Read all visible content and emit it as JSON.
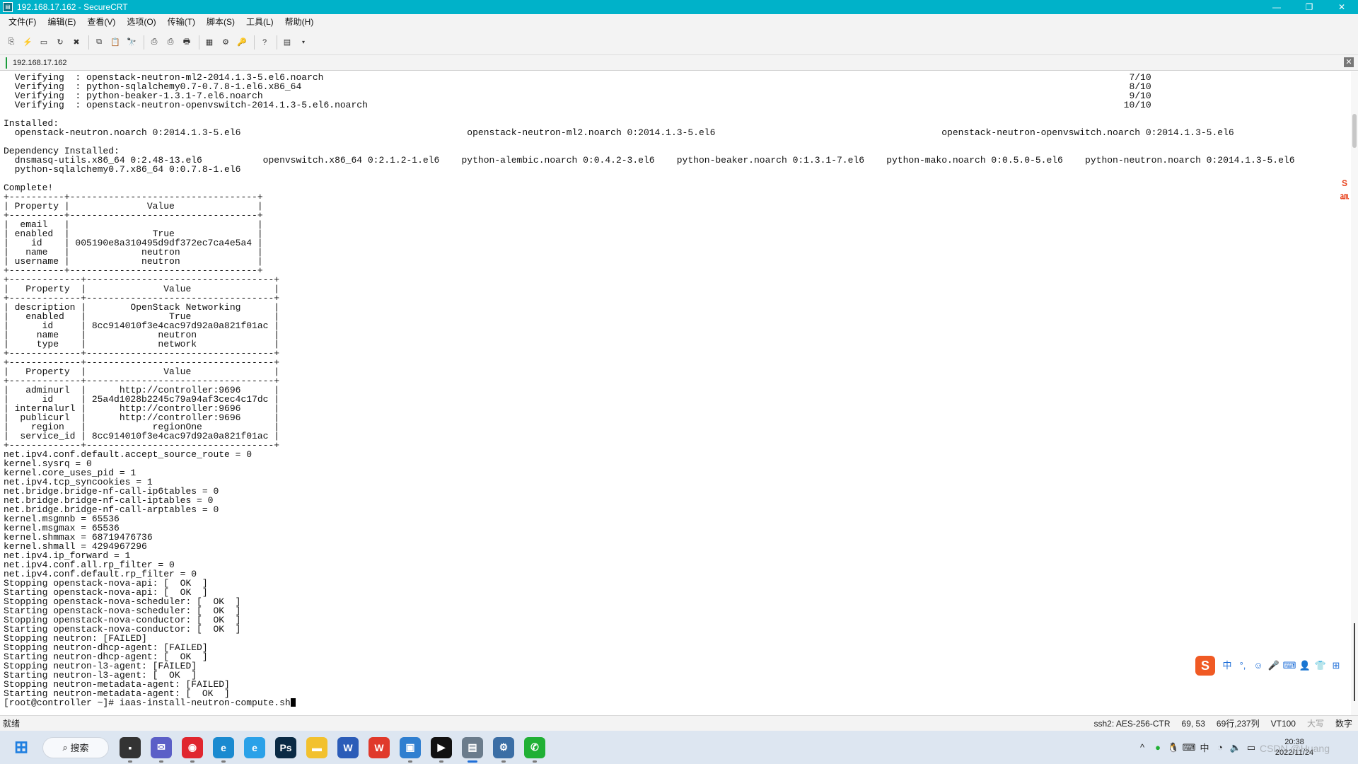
{
  "window": {
    "title": "192.168.17.162 - SecureCRT",
    "app_icon": "securecrt-icon"
  },
  "menu": [
    {
      "label": "文件(F)"
    },
    {
      "label": "编辑(E)"
    },
    {
      "label": "查看(V)"
    },
    {
      "label": "选项(O)"
    },
    {
      "label": "传输(T)"
    },
    {
      "label": "脚本(S)"
    },
    {
      "label": "工具(L)"
    },
    {
      "label": "帮助(H)"
    }
  ],
  "toolbar_icons": [
    "connect-icon",
    "quick-connect-icon",
    "connect-tab-icon",
    "reconnect-icon",
    "disconnect-icon",
    "copy-icon",
    "paste-icon",
    "find-icon",
    "print-icon",
    "print-selection-icon",
    "print-setup-icon",
    "session-options-icon",
    "global-options-icon",
    "keymap-icon",
    "help-icon",
    "sftp-icon"
  ],
  "session_tab": {
    "label": "192.168.17.162"
  },
  "terminal": {
    "lines": [
      "  Verifying  : openstack-neutron-ml2-2014.1.3-5.el6.noarch                                                                                                                                                  7/10",
      "  Verifying  : python-sqlalchemy0.7-0.7.8-1.el6.x86_64                                                                                                                                                      8/10",
      "  Verifying  : python-beaker-1.3.1-7.el6.noarch                                                                                                                                                             9/10",
      "  Verifying  : openstack-neutron-openvswitch-2014.1.3-5.el6.noarch                                                                                                                                         10/10",
      "",
      "Installed:",
      "  openstack-neutron.noarch 0:2014.1.3-5.el6                                         openstack-neutron-ml2.noarch 0:2014.1.3-5.el6                                         openstack-neutron-openvswitch.noarch 0:2014.1.3-5.el6",
      "",
      "Dependency Installed:",
      "  dnsmasq-utils.x86_64 0:2.48-13.el6           openvswitch.x86_64 0:2.1.2-1.el6    python-alembic.noarch 0:0.4.2-3.el6    python-beaker.noarch 0:1.3.1-7.el6    python-mako.noarch 0:0.5.0-5.el6    python-neutron.noarch 0:2014.1.3-5.el6",
      "  python-sqlalchemy0.7.x86_64 0:0.7.8-1.el6",
      "",
      "Complete!",
      "+----------+----------------------------------+",
      "| Property |              Value               |",
      "+----------+----------------------------------+",
      "|  email   |                                  |",
      "| enabled  |               True               |",
      "|    id    | 005190e8a310495d9df372ec7ca4e5a4 |",
      "|   name   |             neutron              |",
      "| username |             neutron              |",
      "+----------+----------------------------------+",
      "+-------------+----------------------------------+",
      "|   Property  |              Value               |",
      "+-------------+----------------------------------+",
      "| description |        OpenStack Networking      |",
      "|   enabled   |               True               |",
      "|      id     | 8cc914010f3e4cac97d92a0a821f01ac |",
      "|     name    |             neutron              |",
      "|     type    |             network              |",
      "+-------------+----------------------------------+",
      "+-------------+----------------------------------+",
      "|   Property  |              Value               |",
      "+-------------+----------------------------------+",
      "|   adminurl  |      http://controller:9696      |",
      "|      id     | 25a4d1028b2245c79a94af3cec4c17dc |",
      "| internalurl |      http://controller:9696      |",
      "|  publicurl  |      http://controller:9696      |",
      "|    region   |            regionOne             |",
      "|  service_id | 8cc914010f3e4cac97d92a0a821f01ac |",
      "+-------------+----------------------------------+",
      "net.ipv4.conf.default.accept_source_route = 0",
      "kernel.sysrq = 0",
      "kernel.core_uses_pid = 1",
      "net.ipv4.tcp_syncookies = 1",
      "net.bridge.bridge-nf-call-ip6tables = 0",
      "net.bridge.bridge-nf-call-iptables = 0",
      "net.bridge.bridge-nf-call-arptables = 0",
      "kernel.msgmnb = 65536",
      "kernel.msgmax = 65536",
      "kernel.shmmax = 68719476736",
      "kernel.shmall = 4294967296",
      "net.ipv4.ip_forward = 1",
      "net.ipv4.conf.all.rp_filter = 0",
      "net.ipv4.conf.default.rp_filter = 0",
      "Stopping openstack-nova-api: [  OK  ]",
      "Starting openstack-nova-api: [  OK  ]",
      "Stopping openstack-nova-scheduler: [  OK  ]",
      "Starting openstack-nova-scheduler: [  OK  ]",
      "Stopping openstack-nova-conductor: [  OK  ]",
      "Starting openstack-nova-conductor: [  OK  ]",
      "Stopping neutron: [FAILED]",
      "Stopping neutron-dhcp-agent: [FAILED]",
      "Starting neutron-dhcp-agent: [  OK  ]",
      "Stopping neutron-l3-agent: [FAILED]",
      "Starting neutron-l3-agent: [  OK  ]",
      "Stopping neutron-metadata-agent: [FAILED]",
      "Starting neutron-metadata-agent: [  OK  ]"
    ],
    "prompt_line": "[root@controller ~]# iaas-install-neutron-compute.sh"
  },
  "statusbar": {
    "ready": "就绪",
    "protocol": "ssh2: AES-256-CTR",
    "cursor_pos": "69,  53",
    "dimensions": "69行,237列",
    "terminal_type": "VT100",
    "caps": "大写",
    "num": "数字"
  },
  "ime": {
    "logo": "S",
    "items": [
      "中",
      "°,",
      "☺",
      "🎤",
      "⌨",
      "👤",
      "👕",
      "⊞"
    ]
  },
  "taskbar": {
    "search_label": "搜索",
    "apps": [
      {
        "name": "start-icon",
        "glyph": "⊞",
        "color": "#1f7fe0"
      },
      {
        "name": "file-explorer-taskview-icon",
        "glyph": "▪",
        "color": "#333333"
      },
      {
        "name": "chat-icon",
        "glyph": "✉",
        "color": "#5b5fc7"
      },
      {
        "name": "netease-music-icon",
        "glyph": "◉",
        "color": "#e0262f"
      },
      {
        "name": "edge-browser-icon",
        "glyph": "e",
        "color": "#1a8ad0"
      },
      {
        "name": "browser-icon",
        "glyph": "e",
        "color": "#2aa1e8"
      },
      {
        "name": "photoshop-icon",
        "glyph": "Ps",
        "color": "#0a2a45"
      },
      {
        "name": "folder-icon",
        "glyph": "▬",
        "color": "#f2c12e"
      },
      {
        "name": "word-icon",
        "glyph": "W",
        "color": "#2b5cb8"
      },
      {
        "name": "wps-icon",
        "glyph": "W",
        "color": "#e0392b"
      },
      {
        "name": "screenshot-tool-icon",
        "glyph": "▣",
        "color": "#2f7fd0"
      },
      {
        "name": "player-icon",
        "glyph": "▶",
        "color": "#111111"
      },
      {
        "name": "securecrt-taskbar-icon",
        "glyph": "▤",
        "color": "#6b7c8c"
      },
      {
        "name": "remote-tool-icon",
        "glyph": "⚙",
        "color": "#3b6ea5"
      },
      {
        "name": "wechat-icon",
        "glyph": "✆",
        "color": "#20b035"
      }
    ],
    "tray": {
      "clock_time": "20:38",
      "clock_date": "2022/11/24",
      "watermark": "CSDN @Huang"
    }
  }
}
